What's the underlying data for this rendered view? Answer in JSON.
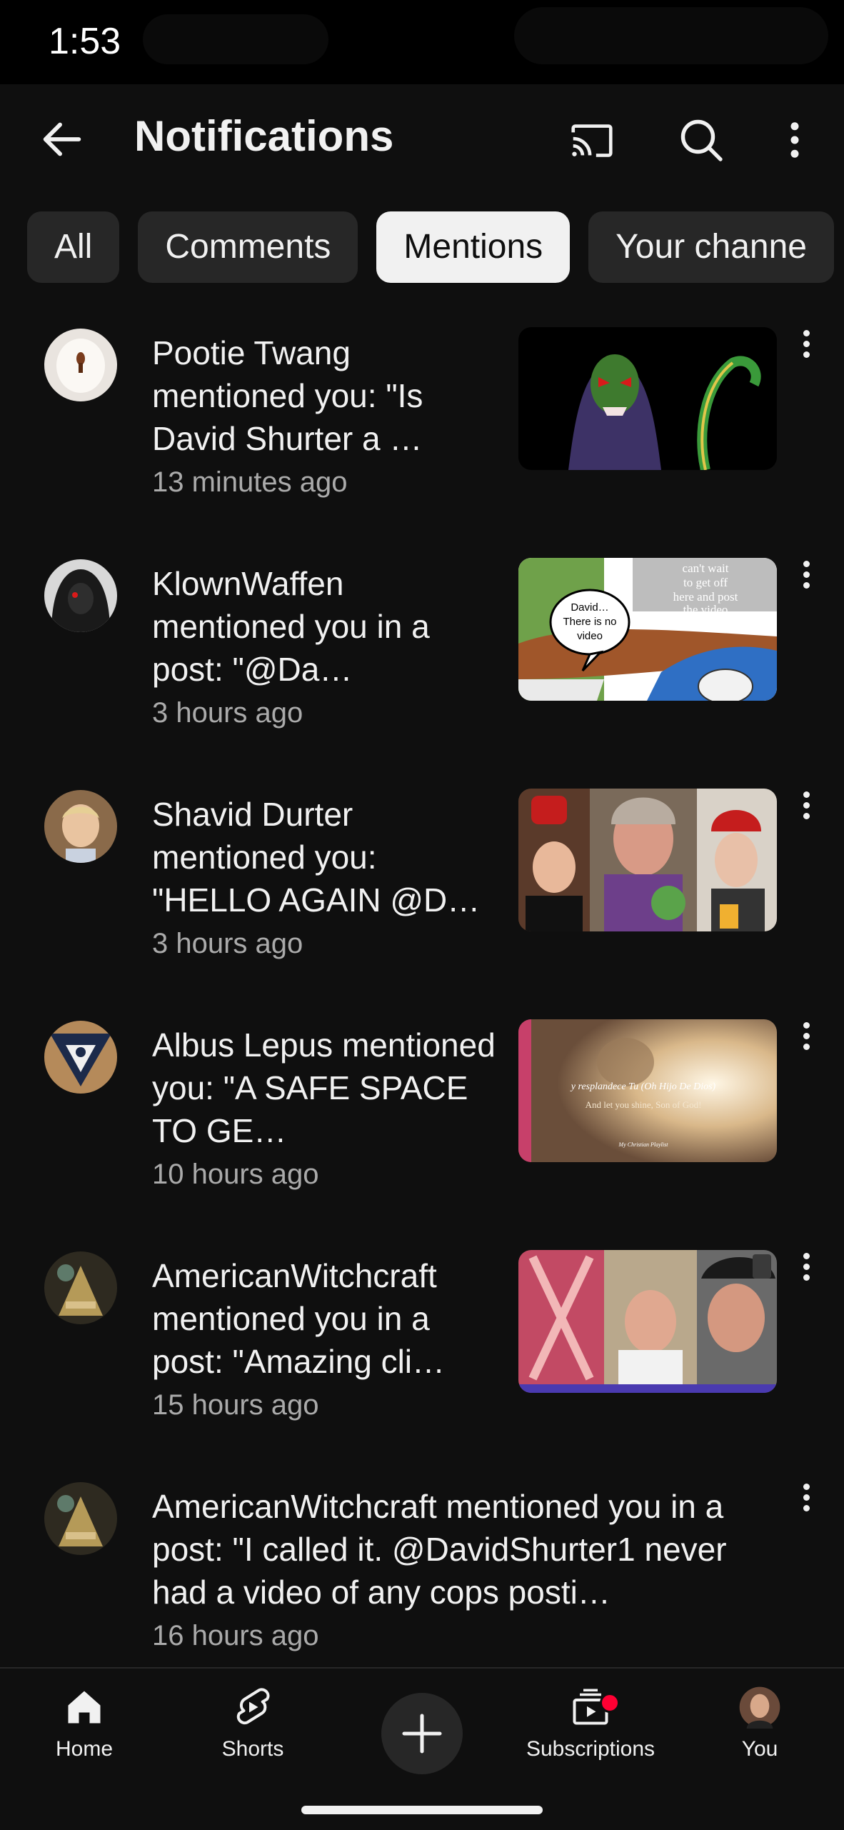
{
  "status": {
    "time": "1:53"
  },
  "header": {
    "title": "Notifications"
  },
  "chips": [
    "All",
    "Comments",
    "Mentions",
    "Your channe"
  ],
  "active_chip": "Mentions",
  "notifications": [
    {
      "message": "Pootie Twang mentioned you: \"Is David Shurter a …",
      "time": "13 minutes ago",
      "avatar": "egg-avatar",
      "thumb": "vampire-cartoon-thumbnail"
    },
    {
      "message": "KlownWaffen mentioned you in a post: \"@Da…",
      "time": "3 hours ago",
      "avatar": "hooded-avatar",
      "thumb": "meme-comic-thumbnail",
      "thumb_text_a": "David… There is no video",
      "thumb_text_b": "can't wait to get off here and post the video"
    },
    {
      "message": "Shavid Durter mentioned you: \"HELLO AGAIN @D…",
      "time": "3 hours ago",
      "avatar": "child-photo-avatar",
      "thumb": "collage-thumbnail"
    },
    {
      "message": "Albus Lepus mentioned you: \"A SAFE SPACE TO GE…",
      "time": "10 hours ago",
      "avatar": "emblem-avatar",
      "thumb": "skull-light-thumbnail",
      "thumb_text_a": "y resplandece Tu (Oh Hijo De Dios)",
      "thumb_text_b": "And let you shine, Son of God!",
      "thumb_text_c": "My Christian Playlist"
    },
    {
      "message": "AmericanWitchcraft mentioned you in a post: \"Amazing cli…",
      "time": "15 hours ago",
      "avatar": "painting-avatar",
      "thumb": "split-video-thumbnail"
    },
    {
      "message": "AmericanWitchcraft mentioned you in a post: \"I called it. @DavidShurter1 never had a video of any cops posti…",
      "time": "16 hours ago",
      "avatar": "painting-avatar"
    }
  ],
  "bottom_nav": {
    "home": "Home",
    "shorts": "Shorts",
    "subscriptions": "Subscriptions",
    "you": "You"
  },
  "colors": {
    "background": "#0f0f0f",
    "chip": "#272727",
    "accent_red": "#ff0033",
    "secondary_text": "#aaaaaa"
  }
}
